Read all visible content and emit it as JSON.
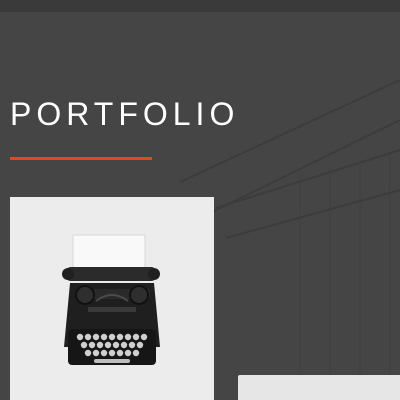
{
  "portfolio": {
    "title": "PORTFOLIO",
    "accent_color": "#e04a1b",
    "items": [
      {
        "image": "vintage-typewriter-photo"
      },
      {
        "image": "light-photo"
      }
    ]
  }
}
